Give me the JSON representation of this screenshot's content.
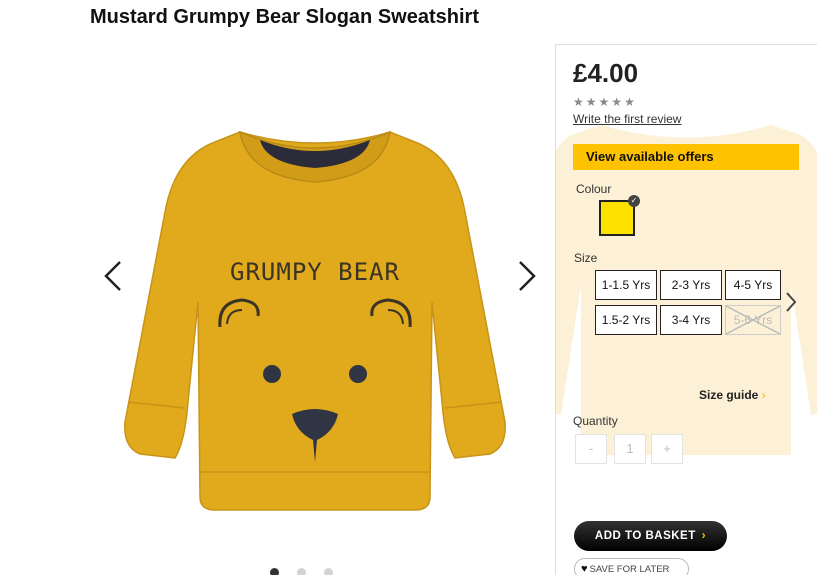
{
  "product": {
    "title": "Mustard Grumpy Bear Slogan Sweatshirt"
  },
  "gallery": {
    "slogan": "GRUMPY BEAR",
    "dots": 3,
    "active_dot": 0
  },
  "panel": {
    "price": "£4.00",
    "rating_stars": "★★★★★",
    "write_review": "Write the first review",
    "offers": "View available offers",
    "colour_label": "Colour",
    "colour_swatch": "#ffe100",
    "size_label": "Size",
    "sizes": [
      {
        "label": "1-1.5 Yrs",
        "available": true
      },
      {
        "label": "2-3 Yrs",
        "available": true
      },
      {
        "label": "4-5 Yrs",
        "available": true
      },
      {
        "label": "1.5-2 Yrs",
        "available": true
      },
      {
        "label": "3-4 Yrs",
        "available": true
      },
      {
        "label": "5-6 Yrs",
        "available": false
      }
    ],
    "size_guide": "Size guide",
    "quantity_label": "Quantity",
    "qty_minus": "-",
    "qty_value": "1",
    "qty_plus": "+",
    "add_to_basket": "ADD TO BASKET",
    "save_for_later": "SAVE FOR LATER"
  },
  "colors": {
    "accent": "#ffc200",
    "mustard": "#e0aa1c"
  },
  "icons": {
    "prev": "chevron-left-icon",
    "next": "chevron-right-icon",
    "heart": "heart-icon",
    "check": "check-icon"
  }
}
